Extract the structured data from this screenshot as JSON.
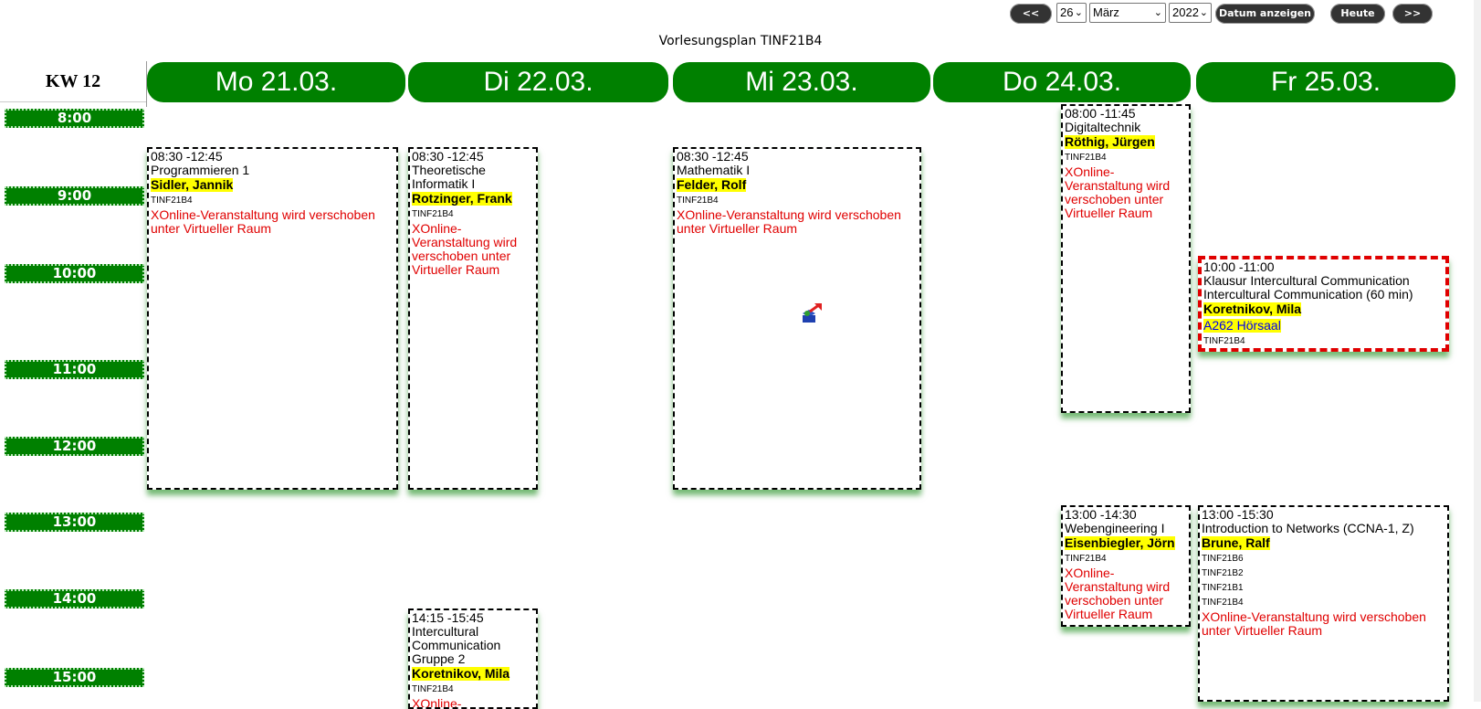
{
  "nav": {
    "prev": "<<",
    "day": "26",
    "month": "März",
    "year": "2022",
    "show_date": "Datum anzeigen",
    "today": "Heute",
    "next": ">>"
  },
  "title": "Vorlesungsplan TINF21B4",
  "week_label": "KW 12",
  "days": [
    "Mo 21.03.",
    "Di 22.03.",
    "Mi 23.03.",
    "Do 24.03.",
    "Fr 25.03."
  ],
  "times": [
    "8:00",
    "9:00",
    "10:00",
    "11:00",
    "12:00",
    "13:00",
    "14:00",
    "15:00"
  ],
  "events": {
    "mo1": {
      "time": "08:30 -12:45",
      "course": "Programmieren 1",
      "lecturer": "Sidler, Jannik",
      "groups": [
        "TINF21B4"
      ],
      "note": "XOnline-Veranstaltung wird verschoben unter Virtueller Raum"
    },
    "di1": {
      "time": "08:30 -12:45",
      "course": "Theoretische Informatik I",
      "lecturer": "Rotzinger, Frank",
      "groups": [
        "TINF21B4"
      ],
      "note": "XOnline-Veranstaltung wird verschoben unter Virtueller Raum"
    },
    "di2": {
      "time": "14:15 -15:45",
      "course": "Intercultural Communication Gruppe 2",
      "lecturer": "Koretnikov, Mila",
      "groups": [
        "TINF21B4"
      ],
      "note": "XOnline-"
    },
    "mi1": {
      "time": "08:30 -12:45",
      "course": "Mathematik I",
      "lecturer": "Felder, Rolf",
      "groups": [
        "TINF21B4"
      ],
      "note": "XOnline-Veranstaltung wird verschoben unter Virtueller Raum"
    },
    "do1": {
      "time": "08:00 -11:45",
      "course": "Digitaltechnik",
      "lecturer": "Röthig, Jürgen",
      "groups": [
        "TINF21B4"
      ],
      "note": "XOnline-Veranstaltung wird verschoben unter Virtueller Raum"
    },
    "do2": {
      "time": "13:00 -14:30",
      "course": "Webengineering I",
      "lecturer": "Eisenbiegler, Jörn",
      "groups": [
        "TINF21B4"
      ],
      "note": "XOnline-Veranstaltung wird verschoben unter Virtueller Raum"
    },
    "fr1": {
      "time": "10:00 -11:00",
      "course": "Klausur Intercultural Communication",
      "course2": "Intercultural Communication (60 min)",
      "lecturer": "Koretnikov, Mila",
      "room": "A262 Hörsaal",
      "groups": [
        "TINF21B4"
      ]
    },
    "fr2": {
      "time": "13:00 -15:30",
      "course": "Introduction to Networks (CCNA-1, Z)",
      "lecturer": "Brune, Ralf",
      "groups": [
        "TINF21B6",
        "TINF21B2",
        "TINF21B1",
        "TINF21B4"
      ],
      "note": "XOnline-Veranstaltung wird verschoben unter Virtueller Raum"
    }
  },
  "colors": {
    "accent": "#008000",
    "highlight": "#ffff00",
    "note": "#e00000",
    "exam_border": "#e00000"
  }
}
